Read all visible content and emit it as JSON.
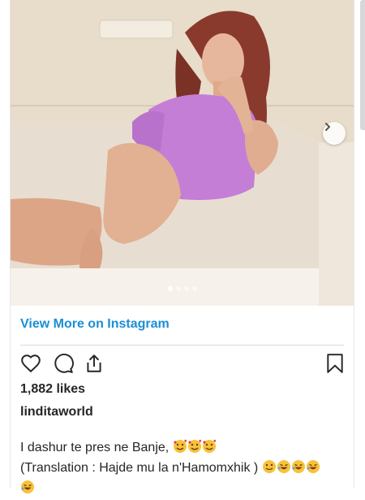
{
  "post": {
    "carousel": {
      "slides": 4,
      "active": 1
    },
    "view_more_label": "View More on Instagram",
    "likes_text": "1,882 likes",
    "username": "linditaworld",
    "caption_line1": "I dashur te pres ne Banje,",
    "caption_line2": "(Translation : Hajde mu la n'Hamomxhik )",
    "emojis_line1": [
      "smiling-face-with-hearts",
      "smiling-face-with-hearts",
      "smiling-face-with-hearts"
    ],
    "emojis_line2": [
      "smiling-face",
      "rolling-laughing",
      "rolling-laughing",
      "rolling-laughing",
      "rolling-laughing"
    ]
  },
  "colors": {
    "link": "#1a8ed6",
    "text": "#262626",
    "divider": "#dbdbdb"
  },
  "icons": [
    "heart-icon",
    "comment-icon",
    "share-icon",
    "bookmark-icon",
    "chevron-right-icon"
  ]
}
